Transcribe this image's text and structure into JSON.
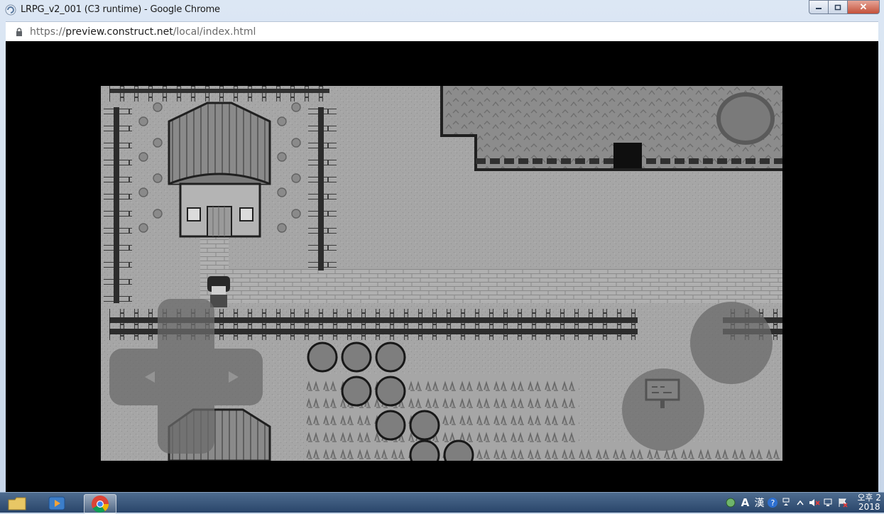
{
  "window": {
    "title": "LRPG_v2_001 (C3 runtime) - Google Chrome",
    "url_prefix": "https://",
    "url_host": "preview.construct.net",
    "url_path": "/local/index.html"
  },
  "taskbar": {
    "items": [
      {
        "name": "file-explorer-icon"
      },
      {
        "name": "media-player-icon"
      },
      {
        "name": "chrome-icon",
        "active": true
      }
    ],
    "tray": {
      "ime_a": "A",
      "ime_han": "漢",
      "help": "?",
      "clock_top": "오후 2",
      "clock_bottom": "2018"
    }
  },
  "colors": {
    "gb_darkest": "#141414",
    "gb_dark": "#525252",
    "gb_mid": "#8c8c8c",
    "gb_light": "#a4a4a4",
    "gb_lightest": "#cfcfcf"
  }
}
